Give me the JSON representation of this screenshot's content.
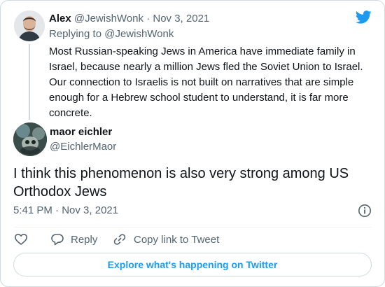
{
  "colors": {
    "brand": "#1d9bf0",
    "text": "#0f1419",
    "muted": "#536471",
    "border": "#cfd9de"
  },
  "icons": {
    "brand": "twitter-bird-icon",
    "info": "info-icon",
    "like": "heart-icon",
    "reply": "reply-bubble-icon",
    "copy": "link-icon"
  },
  "parent_tweet": {
    "name": "Alex",
    "handle": "@JewishWonk",
    "separator": "·",
    "date": "Nov 3, 2021",
    "replying_label": "Replying to",
    "replying_handle": "@JewishWonk",
    "text": "Most Russian-speaking Jews in America have immediate family in Israel, because nearly a million Jews fled the Soviet Union to Israel. Our connection to Israelis is not built on narratives that are simple enough for a Hebrew school student to understand, it is far more concrete."
  },
  "main_tweet": {
    "name": "maor eichler",
    "handle": "@EichlerMaor",
    "text": "I think this phenomenon is also very strong among US Orthodox Jews",
    "time": "5:41 PM",
    "separator": "·",
    "date": "Nov 3, 2021"
  },
  "actions": {
    "reply_label": "Reply",
    "copy_label": "Copy link to Tweet"
  },
  "explore_label": "Explore what's happening on Twitter"
}
